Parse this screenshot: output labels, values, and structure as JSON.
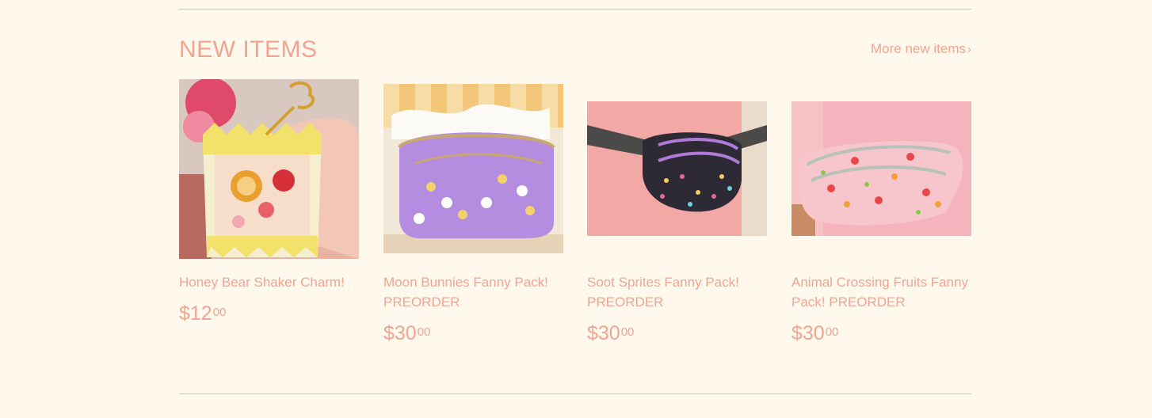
{
  "section": {
    "title": "NEW ITEMS",
    "more_link": "More new items",
    "more_chevron": "›"
  },
  "products": [
    {
      "title": "Honey Bear Shaker Charm!",
      "price_main": "$12",
      "price_cents": "00",
      "image_icon": "shaker-charm-photo"
    },
    {
      "title": "Moon Bunnies Fanny Pack! PREORDER",
      "price_main": "$30",
      "price_cents": "00",
      "image_icon": "purple-fanny-pack-photo"
    },
    {
      "title": "Soot Sprites Fanny Pack! PREORDER",
      "price_main": "$30",
      "price_cents": "00",
      "image_icon": "black-fanny-pack-photo"
    },
    {
      "title": "Animal Crossing Fruits Fanny Pack! PREORDER",
      "price_main": "$30",
      "price_cents": "00",
      "image_icon": "pink-fanny-pack-photo"
    }
  ],
  "colors": {
    "background": "#fff8ed",
    "accent": "#f0a592",
    "rule": "#f0b8a8"
  }
}
